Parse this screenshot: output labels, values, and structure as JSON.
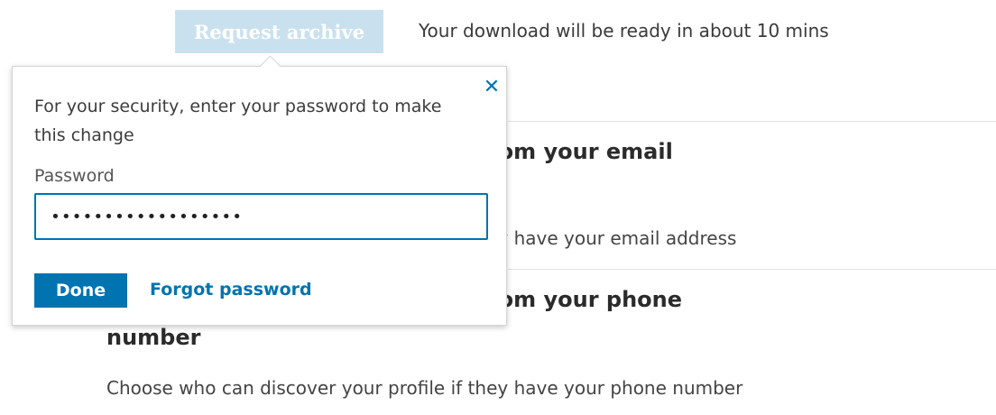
{
  "top_bar": {
    "request_archive_label": "Request archive",
    "download_note": "Your download will be ready in about 10 mins"
  },
  "sections": {
    "email": {
      "title_visible": "profile from your email",
      "description_visible": "hey have your email address"
    },
    "phone": {
      "title_visible": "profile from your phone",
      "title_line2": "number",
      "description": "Choose who can discover your profile if they have your phone number"
    }
  },
  "popover": {
    "close_icon": "✕",
    "prompt": "For your security, enter your password to make this change",
    "password_label": "Password",
    "password_value": "••••••••••••••••••",
    "done_label": "Done",
    "forgot_label": "Forgot password"
  },
  "colors": {
    "accent": "#0073b1",
    "disabled_button": "#c9e1ef"
  }
}
